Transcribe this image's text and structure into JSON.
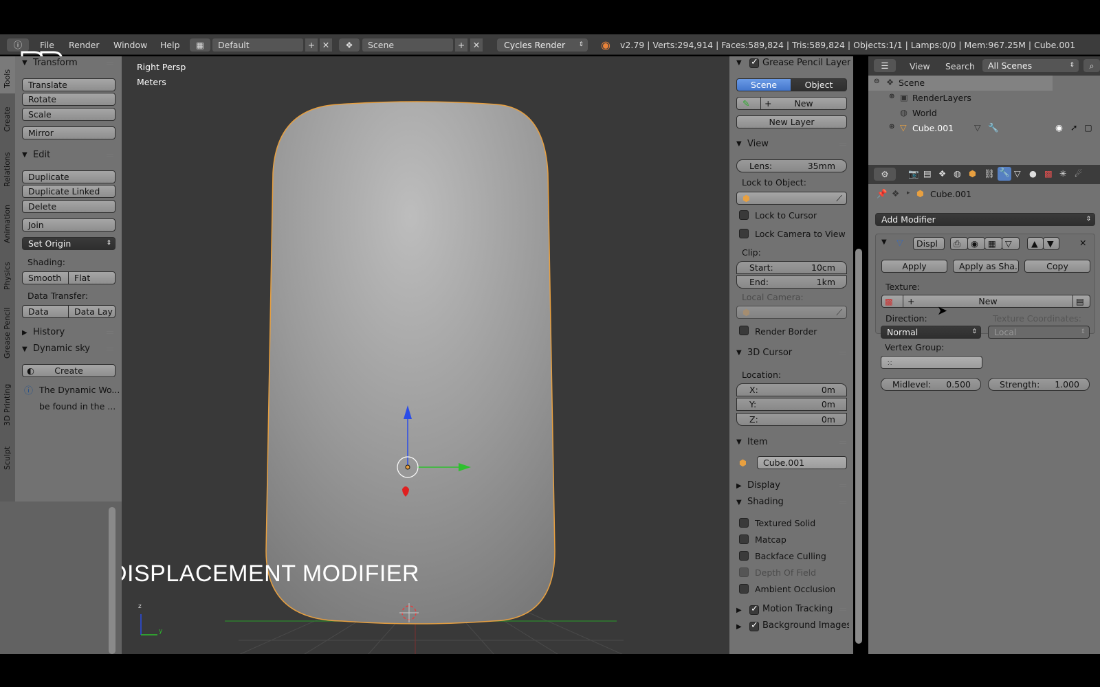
{
  "topbar": {
    "menus": [
      "File",
      "Render",
      "Window",
      "Help"
    ],
    "layout": "Default",
    "scene": "Scene",
    "engine": "Cycles Render",
    "stats": "v2.79 | Verts:294,914 | Faces:589,824 | Tris:589,824 | Objects:1/1 | Lamps:0/0 | Mem:967.25M | Cube.001"
  },
  "vtabs": [
    "Tools",
    "Create",
    "Relations",
    "Animation",
    "Physics",
    "Grease Pencil",
    "3D Printing",
    "Sculpt"
  ],
  "tools": {
    "transform_header": "Transform",
    "translate": "Translate",
    "rotate": "Rotate",
    "scale": "Scale",
    "mirror": "Mirror",
    "edit_header": "Edit",
    "duplicate": "Duplicate",
    "duplicate_linked": "Duplicate Linked",
    "delete": "Delete",
    "join": "Join",
    "set_origin": "Set Origin",
    "shading_label": "Shading:",
    "smooth": "Smooth",
    "flat": "Flat",
    "data_transfer_label": "Data Transfer:",
    "data": "Data",
    "data_lay": "Data Lay",
    "history_header": "History",
    "dynamic_sky_header": "Dynamic sky",
    "create": "Create",
    "info_line1": "The Dynamic Wo...",
    "info_line2": "be found in the ..."
  },
  "viewport": {
    "view_name": "Right Persp",
    "units": "Meters",
    "overlay_title": "DISPLACEMENT MODIFIER",
    "axis_z": "z",
    "axis_y": "y"
  },
  "npanel": {
    "grease_header": "Grease Pencil Layers",
    "scene_tab": "Scene",
    "object_tab": "Object",
    "new": "New",
    "new_layer": "New Layer",
    "view_header": "View",
    "lens_label": "Lens:",
    "lens_value": "35mm",
    "lock_to_object": "Lock to Object:",
    "lock_to_cursor": "Lock to Cursor",
    "lock_camera": "Lock Camera to View",
    "clip_label": "Clip:",
    "start_label": "Start:",
    "start_value": "10cm",
    "end_label": "End:",
    "end_value": "1km",
    "local_camera": "Local Camera:",
    "render_border": "Render Border",
    "cursor_header": "3D Cursor",
    "location_label": "Location:",
    "x_label": "X:",
    "x_value": "0m",
    "y_label": "Y:",
    "y_value": "0m",
    "z_label": "Z:",
    "z_value": "0m",
    "item_header": "Item",
    "item_name": "Cube.001",
    "display_header": "Display",
    "shading_header": "Shading",
    "textured_solid": "Textured Solid",
    "matcap": "Matcap",
    "backface_culling": "Backface Culling",
    "depth_of_field": "Depth Of Field",
    "ambient_occlusion": "Ambient Occlusion",
    "motion_tracking": "Motion Tracking",
    "background_images": "Background Images"
  },
  "outliner": {
    "view": "View",
    "search": "Search",
    "all_scenes": "All Scenes",
    "scene": "Scene",
    "render_layers": "RenderLayers",
    "world": "World",
    "cube": "Cube.001"
  },
  "properties": {
    "object_name": "Cube.001",
    "add_modifier": "Add Modifier",
    "modifier_name": "Displ",
    "apply": "Apply",
    "apply_as_shape": "Apply as Sha...",
    "copy": "Copy",
    "texture_label": "Texture:",
    "texture_new": "New",
    "direction_label": "Direction:",
    "direction_value": "Normal",
    "texcoords_label": "Texture Coordinates:",
    "texcoords_value": "Local",
    "vertex_group_label": "Vertex Group:",
    "midlevel_label": "Midlevel:",
    "midlevel_value": "0.500",
    "strength_label": "Strength:",
    "strength_value": "1.000"
  },
  "colors": {
    "panel": "#727272",
    "viewport": "#393939",
    "selection_outline": "#e8a040",
    "accent_blue": "#5680c2"
  }
}
